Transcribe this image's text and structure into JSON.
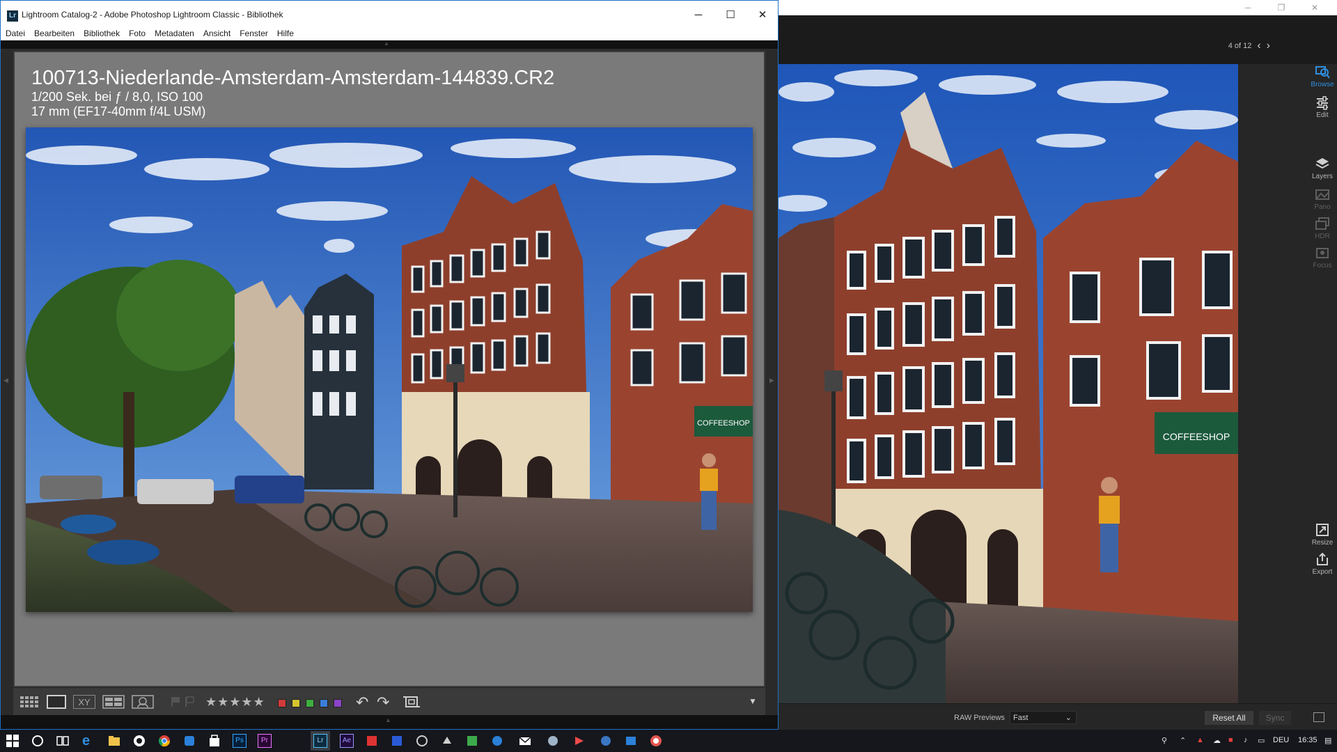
{
  "lightroom": {
    "title": "Lightroom Catalog-2 - Adobe Photoshop Lightroom Classic - Bibliothek",
    "app_icon_label": "Lr",
    "window_buttons": {
      "minimize": "─",
      "maximize": "☐",
      "close": "✕"
    },
    "menu": [
      "Datei",
      "Bearbeiten",
      "Bibliothek",
      "Foto",
      "Metadaten",
      "Ansicht",
      "Fenster",
      "Hilfe"
    ],
    "loupe_info": {
      "filename": "100713-Niederlande-Amsterdam-Amsterdam-144839.CR2",
      "exposure": "1/200 Sek. bei ƒ / 8,0, ISO 100",
      "lens": "17 mm (EF17-40mm f/4L USM)"
    },
    "toolbar": {
      "xy_label": "XY",
      "stars": "★★★★★",
      "color_labels": [
        "#d23a3a",
        "#d6c531",
        "#3fae3f",
        "#3a7ed8",
        "#8c44c8"
      ],
      "dropdown": "▼"
    }
  },
  "right_app": {
    "window_buttons": {
      "minimize": "─",
      "restore": "❐",
      "close": "✕"
    },
    "navigation": {
      "counter": "4 of 12",
      "prev": "‹",
      "next": "›"
    },
    "sidebar": [
      {
        "label": "Browse",
        "icon": "browse-icon",
        "state": "active"
      },
      {
        "label": "Edit",
        "icon": "edit-sliders-icon",
        "state": "normal"
      },
      {
        "label": "Layers",
        "icon": "layers-icon",
        "state": "normal"
      },
      {
        "label": "Pano",
        "icon": "pano-icon",
        "state": "disabled"
      },
      {
        "label": "HDR",
        "icon": "hdr-icon",
        "state": "disabled"
      },
      {
        "label": "Focus",
        "icon": "focus-icon",
        "state": "disabled"
      },
      {
        "label": "Resize",
        "icon": "resize-icon",
        "state": "normal"
      },
      {
        "label": "Export",
        "icon": "export-icon",
        "state": "normal"
      }
    ],
    "raw_previews_label": "RAW Previews",
    "raw_previews_value": "Fast",
    "reset_all": "Reset All",
    "sync": "Sync"
  },
  "taskbar": {
    "apps": [
      "start-icon",
      "cortana-icon",
      "task-view-icon",
      "edge-icon",
      "file-explorer-icon",
      "app-icon",
      "chrome-icon",
      "app-icon",
      "store-icon",
      "photoshop-icon",
      "premiere-icon",
      "lightroom-icon",
      "after-effects-icon",
      "app-icon",
      "app-icon",
      "app-icon",
      "app-icon",
      "app-icon",
      "mail-icon",
      "app-icon",
      "app-icon",
      "app-icon",
      "app-icon",
      "app-icon"
    ],
    "app_labels": {
      "ps": "Ps",
      "pr": "Pr",
      "lr": "Lr",
      "ae": "Ae"
    },
    "language": "DEU",
    "time": "16:35"
  }
}
